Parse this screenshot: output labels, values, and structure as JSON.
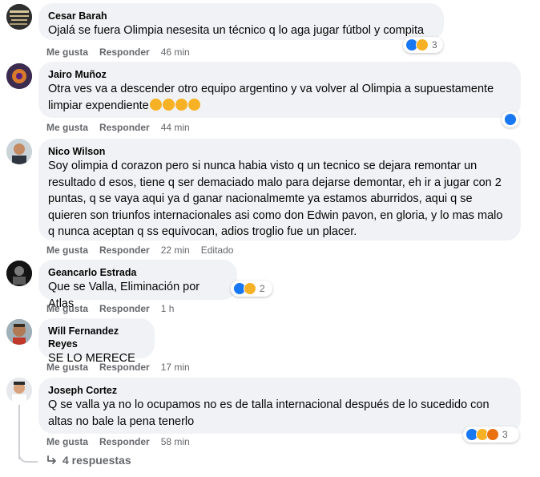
{
  "comments": [
    {
      "name": "Cesar Barah",
      "text": "Ojalá se fuera Olimpia nesesita un técnico q lo aga jugar fútbol y compita",
      "like": "Me gusta",
      "reply": "Responder",
      "time": "46 min",
      "reactions": [
        "like-icon",
        "haha-icon"
      ],
      "reaction_count": "3"
    },
    {
      "name": "Jairo Muñoz",
      "text": "Otra ves va a descender otro equipo argentino y va volver al Olimpia a supuestamente limpiar expendiente",
      "emoji_trail": [
        "rolling-laughing-icon",
        "rolling-laughing-icon",
        "rolling-laughing-icon",
        "rolling-laughing-icon"
      ],
      "like": "Me gusta",
      "reply": "Responder",
      "time": "44 min",
      "reactions": [
        "like-icon"
      ]
    },
    {
      "name": "Nico Wilson",
      "text": "Soy olimpia d corazon pero si nunca habia visto q un tecnico se dejara remontar un resultado d esos, tiene q ser demaciado malo para dejarse demontar, eh ir a jugar con 2 puntas, q se vaya aqui ya d ganar nacionalmemte ya estamos aburridos, aqui q se quieren son triunfos internacionales asi como don Edwin pavon, en gloria, y lo mas malo q nunca aceptan q ss equivocan, adios troglio fue un placer.",
      "like": "Me gusta",
      "reply": "Responder",
      "time": "22 min",
      "edited": "Editado"
    },
    {
      "name": "Geancarlo Estrada",
      "text": "Que se Valla, Eliminación por Atlas",
      "like": "Me gusta",
      "reply": "Responder",
      "time": "1 h",
      "reactions": [
        "like-icon",
        "haha-icon"
      ],
      "reaction_count": "2"
    },
    {
      "name": "Will Fernandez Reyes",
      "text": "SE LO MERECE",
      "like": "Me gusta",
      "reply": "Responder",
      "time": "17 min"
    },
    {
      "name": "Joseph Cortez",
      "text": "Q se valla ya no lo ocupamos no es de talla internacional después de lo sucedido con altas no bale la pena tenerlo",
      "like": "Me gusta",
      "reply": "Responder",
      "time": "58 min",
      "reactions": [
        "like-icon",
        "haha-icon",
        "angry-icon"
      ],
      "reaction_count": "3"
    }
  ],
  "replies_link": "4 respuestas",
  "colors": {
    "like": "#1877f2",
    "haha": "#f7b125",
    "angry": "#e9710f",
    "bubble": "#f0f2f5",
    "meta": "#65676b"
  }
}
